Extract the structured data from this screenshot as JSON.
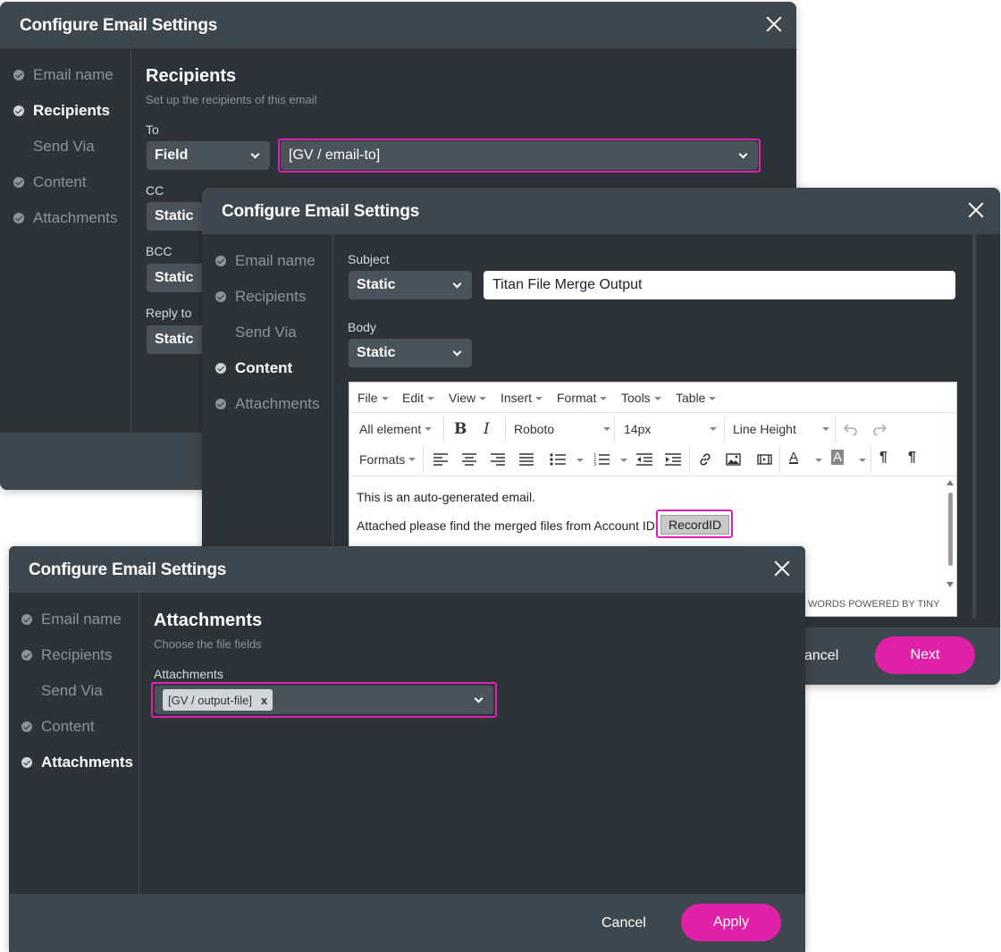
{
  "dialog1": {
    "title": "Configure Email Settings",
    "steps": [
      "Email name",
      "Recipients",
      "Send Via",
      "Content",
      "Attachments"
    ],
    "section_title": "Recipients",
    "section_subtitle": "Set up the recipients of this email",
    "to_label": "To",
    "to_type": "Field",
    "to_value": "[GV / email-to]",
    "cc_label": "CC",
    "cc_type": "Static",
    "bcc_label": "BCC",
    "bcc_type": "Static",
    "reply_label": "Reply to",
    "reply_type": "Static"
  },
  "dialog2": {
    "title": "Configure Email Settings",
    "steps": [
      "Email name",
      "Recipients",
      "Send Via",
      "Content",
      "Attachments"
    ],
    "subject_label": "Subject",
    "subject_type": "Static",
    "subject_value": "Titan File Merge Output",
    "body_label": "Body",
    "body_type": "Static",
    "menu": [
      "File",
      "Edit",
      "View",
      "Insert",
      "Format",
      "Tools",
      "Table"
    ],
    "toolbar": {
      "block": "All element",
      "font": "Roboto",
      "size": "14px",
      "line_height": "Line Height",
      "formats": "Formats"
    },
    "body_line1": "This is an auto-generated email.",
    "body_line2": "Attached please find the merged files from Account ID",
    "token": "RecordID",
    "status": "WORDS POWERED BY TINY",
    "cancel": "ancel",
    "next": "Next"
  },
  "dialog3": {
    "title": "Configure Email Settings",
    "steps": [
      "Email name",
      "Recipients",
      "Send Via",
      "Content",
      "Attachments"
    ],
    "section_title": "Attachments",
    "section_subtitle": "Choose the file fields",
    "attachments_label": "Attachments",
    "chip": "[GV / output-file]",
    "chip_remove": "x",
    "cancel": "Cancel",
    "apply": "Apply"
  },
  "colors": {
    "dialog_bg": "#2d3338",
    "header_bg": "#3f474e",
    "accent_pink": "#e020a8",
    "highlight_border": "#e020b2"
  }
}
